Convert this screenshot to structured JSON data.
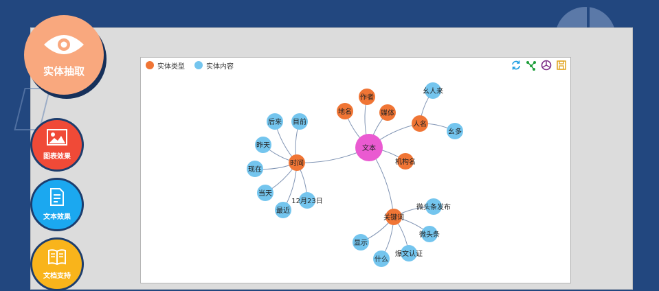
{
  "sidebar": {
    "main": {
      "label": "实体抽取",
      "icon": "eye-icon"
    },
    "buttons": [
      {
        "label": "图表效果",
        "icon": "image-icon"
      },
      {
        "label": "文本效果",
        "icon": "document-icon"
      },
      {
        "label": "文档支持",
        "icon": "book-icon"
      }
    ]
  },
  "legend": {
    "entity_type": {
      "label": "实体类型",
      "color": "#f07535"
    },
    "entity_content": {
      "label": "实体内容",
      "color": "#74c5ee"
    }
  },
  "toolbar": [
    "refresh-icon",
    "graph-layout-icon",
    "color-wheel-icon",
    "save-icon"
  ],
  "graph": {
    "nodes": [
      {
        "id": "root",
        "label": "文本",
        "kind": "root"
      },
      {
        "id": "author",
        "label": "作者",
        "kind": "type"
      },
      {
        "id": "place",
        "label": "地名",
        "kind": "type"
      },
      {
        "id": "media",
        "label": "媒体",
        "kind": "type"
      },
      {
        "id": "person",
        "label": "人名",
        "kind": "type"
      },
      {
        "id": "org",
        "label": "机构名",
        "kind": "type"
      },
      {
        "id": "time",
        "label": "时间",
        "kind": "type"
      },
      {
        "id": "keyword",
        "label": "关键词",
        "kind": "type"
      },
      {
        "id": "p1",
        "label": "幺人来",
        "kind": "content"
      },
      {
        "id": "p2",
        "label": "幺多",
        "kind": "content"
      },
      {
        "id": "t1",
        "label": "后来",
        "kind": "content"
      },
      {
        "id": "t2",
        "label": "目前",
        "kind": "content"
      },
      {
        "id": "t3",
        "label": "昨天",
        "kind": "content"
      },
      {
        "id": "t4",
        "label": "现在",
        "kind": "content"
      },
      {
        "id": "t5",
        "label": "当天",
        "kind": "content"
      },
      {
        "id": "t6",
        "label": "最近",
        "kind": "content"
      },
      {
        "id": "t7",
        "label": "12月23日",
        "kind": "content"
      },
      {
        "id": "k1",
        "label": "微头条发布",
        "kind": "content"
      },
      {
        "id": "k2",
        "label": "微头条",
        "kind": "content"
      },
      {
        "id": "k3",
        "label": "爆文认证",
        "kind": "content"
      },
      {
        "id": "k4",
        "label": "什么",
        "kind": "content"
      },
      {
        "id": "k5",
        "label": "显示",
        "kind": "content"
      }
    ],
    "edges": [
      [
        "root",
        "author"
      ],
      [
        "root",
        "place"
      ],
      [
        "root",
        "media"
      ],
      [
        "root",
        "person"
      ],
      [
        "root",
        "org"
      ],
      [
        "root",
        "time"
      ],
      [
        "root",
        "keyword"
      ],
      [
        "person",
        "p1"
      ],
      [
        "person",
        "p2"
      ],
      [
        "time",
        "t1"
      ],
      [
        "time",
        "t2"
      ],
      [
        "time",
        "t3"
      ],
      [
        "time",
        "t4"
      ],
      [
        "time",
        "t5"
      ],
      [
        "time",
        "t6"
      ],
      [
        "time",
        "t7"
      ],
      [
        "keyword",
        "k1"
      ],
      [
        "keyword",
        "k2"
      ],
      [
        "keyword",
        "k3"
      ],
      [
        "keyword",
        "k4"
      ],
      [
        "keyword",
        "k5"
      ]
    ],
    "colors": {
      "root": "#ea5ad1",
      "type": "#f07535",
      "content": "#74c5ee",
      "edge": "#7f93b3"
    }
  }
}
